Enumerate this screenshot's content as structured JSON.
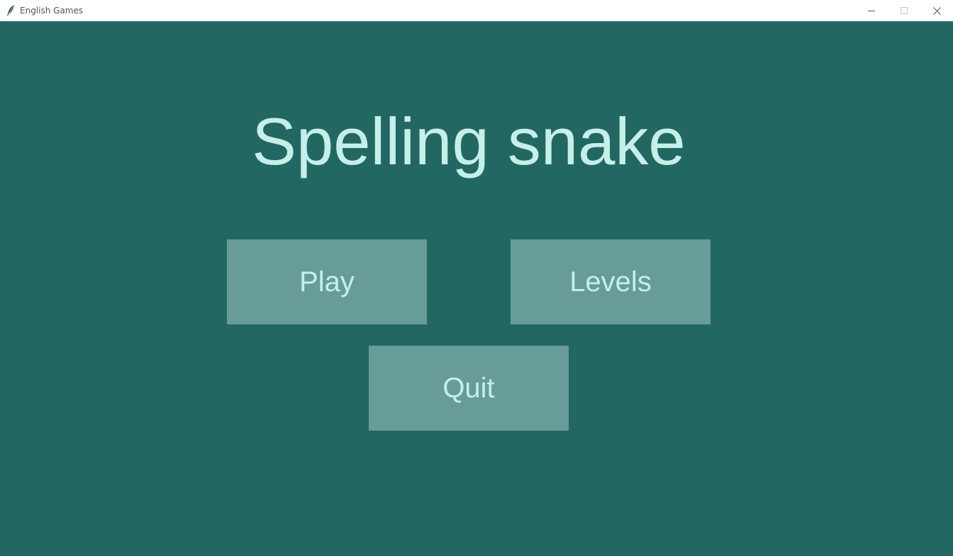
{
  "window": {
    "title": "English Games",
    "app_icon": "feather-icon",
    "controls": {
      "minimize_icon": "minimize-icon",
      "maximize_icon": "maximize-icon",
      "close_icon": "close-icon"
    }
  },
  "game": {
    "title": "Spelling snake"
  },
  "menu": {
    "play_label": "Play",
    "levels_label": "Levels",
    "quit_label": "Quit"
  },
  "colors": {
    "background": "#226762",
    "button": "#689c98",
    "text": "#c6efe9",
    "titlebar": "#ffffff"
  }
}
